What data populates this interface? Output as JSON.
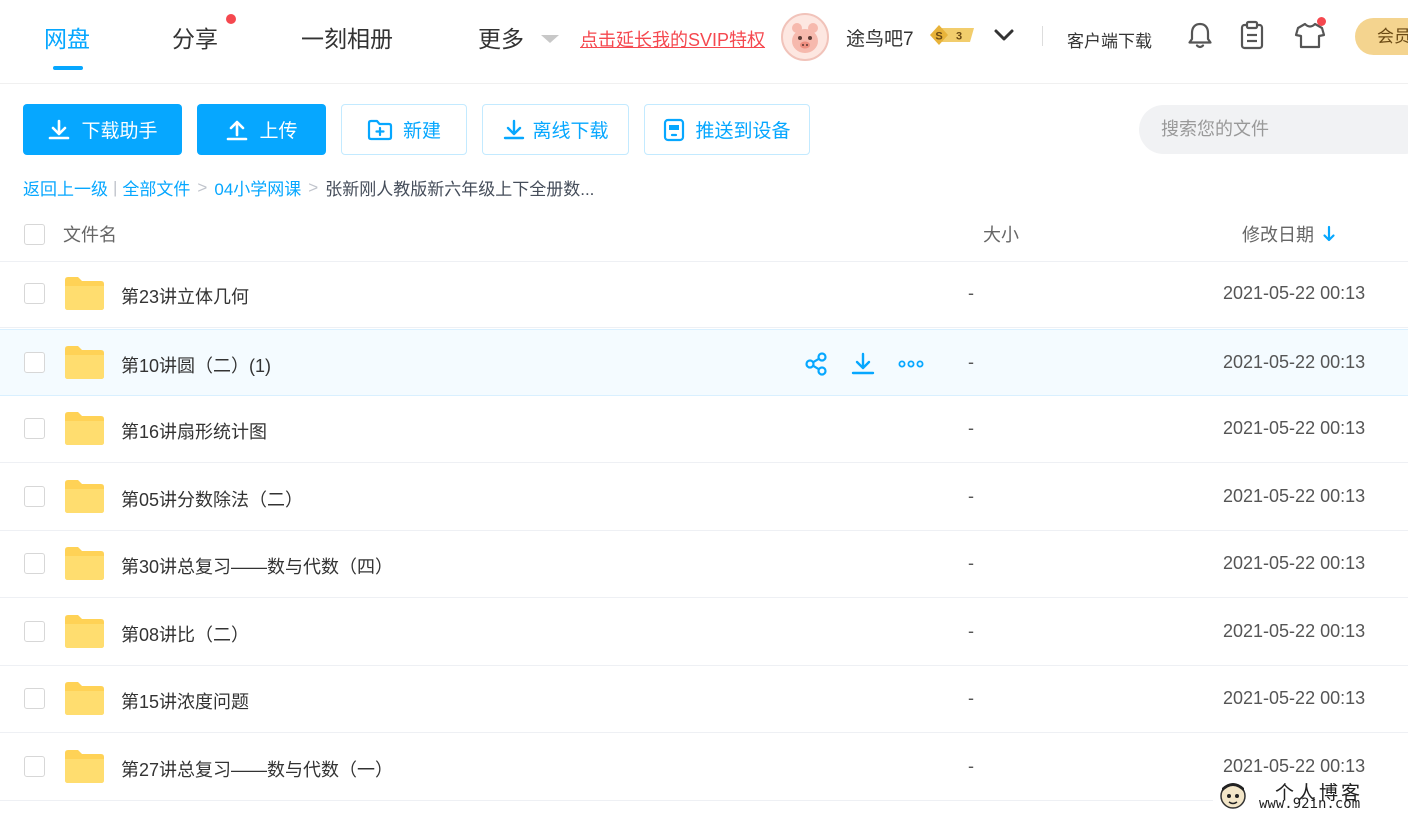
{
  "nav": {
    "tabs": [
      {
        "label": "网盘",
        "active": true
      },
      {
        "label": "分享",
        "badge": true
      },
      {
        "label": "一刻相册"
      },
      {
        "label": "更多"
      }
    ],
    "svip_link": "点击延长我的SVIP特权",
    "user": {
      "name": "途鸟吧7",
      "vip_badge_symbol": "S",
      "vip_level": "3"
    },
    "client_download": "客户端下载",
    "member_button": "会员",
    "icons": [
      "bell-icon",
      "clipboard-icon",
      "tshirt-icon"
    ]
  },
  "toolbar": {
    "download_helper": "下载助手",
    "upload": "上传",
    "new_folder": "新建",
    "offline_download": "离线下载",
    "push_to_device": "推送到设备",
    "search_placeholder": "搜索您的文件"
  },
  "breadcrumb": {
    "back": "返回上一级",
    "divider": "|",
    "all_files": "全部文件",
    "sep": ">",
    "folder": "04小学网课",
    "current": "张新刚人教版新六年级上下全册数..."
  },
  "table": {
    "columns": {
      "name": "文件名",
      "size": "大小",
      "modified": "修改日期"
    },
    "sort": {
      "column": "modified",
      "direction": "desc"
    },
    "rows": [
      {
        "name": "第23讲立体几何",
        "size": "-",
        "modified": "2021-05-22 00:13"
      },
      {
        "name": "第10讲圆（二）(1)",
        "size": "-",
        "modified": "2021-05-22 00:13",
        "hovered": true
      },
      {
        "name": "第16讲扇形统计图",
        "size": "-",
        "modified": "2021-05-22 00:13"
      },
      {
        "name": "第05讲分数除法（二）",
        "size": "-",
        "modified": "2021-05-22 00:13"
      },
      {
        "name": "第30讲总复习——数与代数（四）",
        "size": "-",
        "modified": "2021-05-22 00:13"
      },
      {
        "name": "第08讲比（二）",
        "size": "-",
        "modified": "2021-05-22 00:13"
      },
      {
        "name": "第15讲浓度问题",
        "size": "-",
        "modified": "2021-05-22 00:13"
      },
      {
        "name": "第27讲总复习——数与代数（一）",
        "size": "-",
        "modified": "2021-05-22 00:13"
      }
    ],
    "row_actions": [
      "share-icon",
      "download-icon",
      "more-icon"
    ]
  },
  "watermark": {
    "title": "个人博客",
    "url": "www.92in.com"
  },
  "colors": {
    "accent": "#06a7ff",
    "red": "#f5484f",
    "folder": "#ffd256",
    "member": "#f4d48f"
  }
}
